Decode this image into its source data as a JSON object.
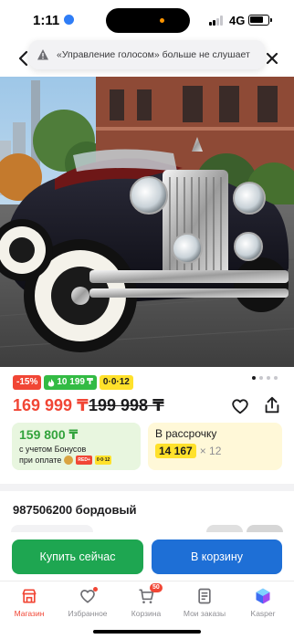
{
  "status_bar": {
    "time": "1:11",
    "network": "4G"
  },
  "toast": {
    "icon": "warning-icon",
    "text": "«Управление голосом» больше не слушает"
  },
  "product": {
    "image_alt": "Детский электромобиль ретро, черный с красным салоном",
    "gallery": {
      "total": 4,
      "active": 0
    }
  },
  "badges": {
    "discount": "-15%",
    "bonus": "10 199",
    "bonus_currency": "₸",
    "installment": "0·0·12"
  },
  "price": {
    "current": "169 999 ₸",
    "old": "199 998 ₸"
  },
  "bonus_card": {
    "amount": "159 800 ₸",
    "caption": "с учетом Бонусов",
    "pay_label": "при оплате",
    "pay_icons": [
      "gold-icon",
      "red-icon",
      "yellow-icon"
    ],
    "red_icon_text": "RED+",
    "yellow_icon_text": "0·0·12"
  },
  "installment_card": {
    "title": "В рассрочку",
    "amount": "14 167",
    "term": "× 12"
  },
  "title": "987506200 бордовый",
  "actions": {
    "buy_now": "Купить сейчас",
    "add_to_cart": "В корзину"
  },
  "tabs": [
    {
      "label": "Магазин",
      "icon": "shop-icon",
      "active": true
    },
    {
      "label": "Избранное",
      "icon": "heart-icon",
      "active": false
    },
    {
      "label": "Корзина",
      "icon": "cart-icon",
      "active": false,
      "badge": "50"
    },
    {
      "label": "Мои заказы",
      "icon": "orders-icon",
      "active": false
    },
    {
      "label": "Kasper",
      "icon": "kasper-icon",
      "active": false
    }
  ],
  "colors": {
    "accent_red": "#f14635",
    "green": "#1ea651",
    "blue": "#1e6fd6",
    "yellow": "#ffe12b"
  }
}
